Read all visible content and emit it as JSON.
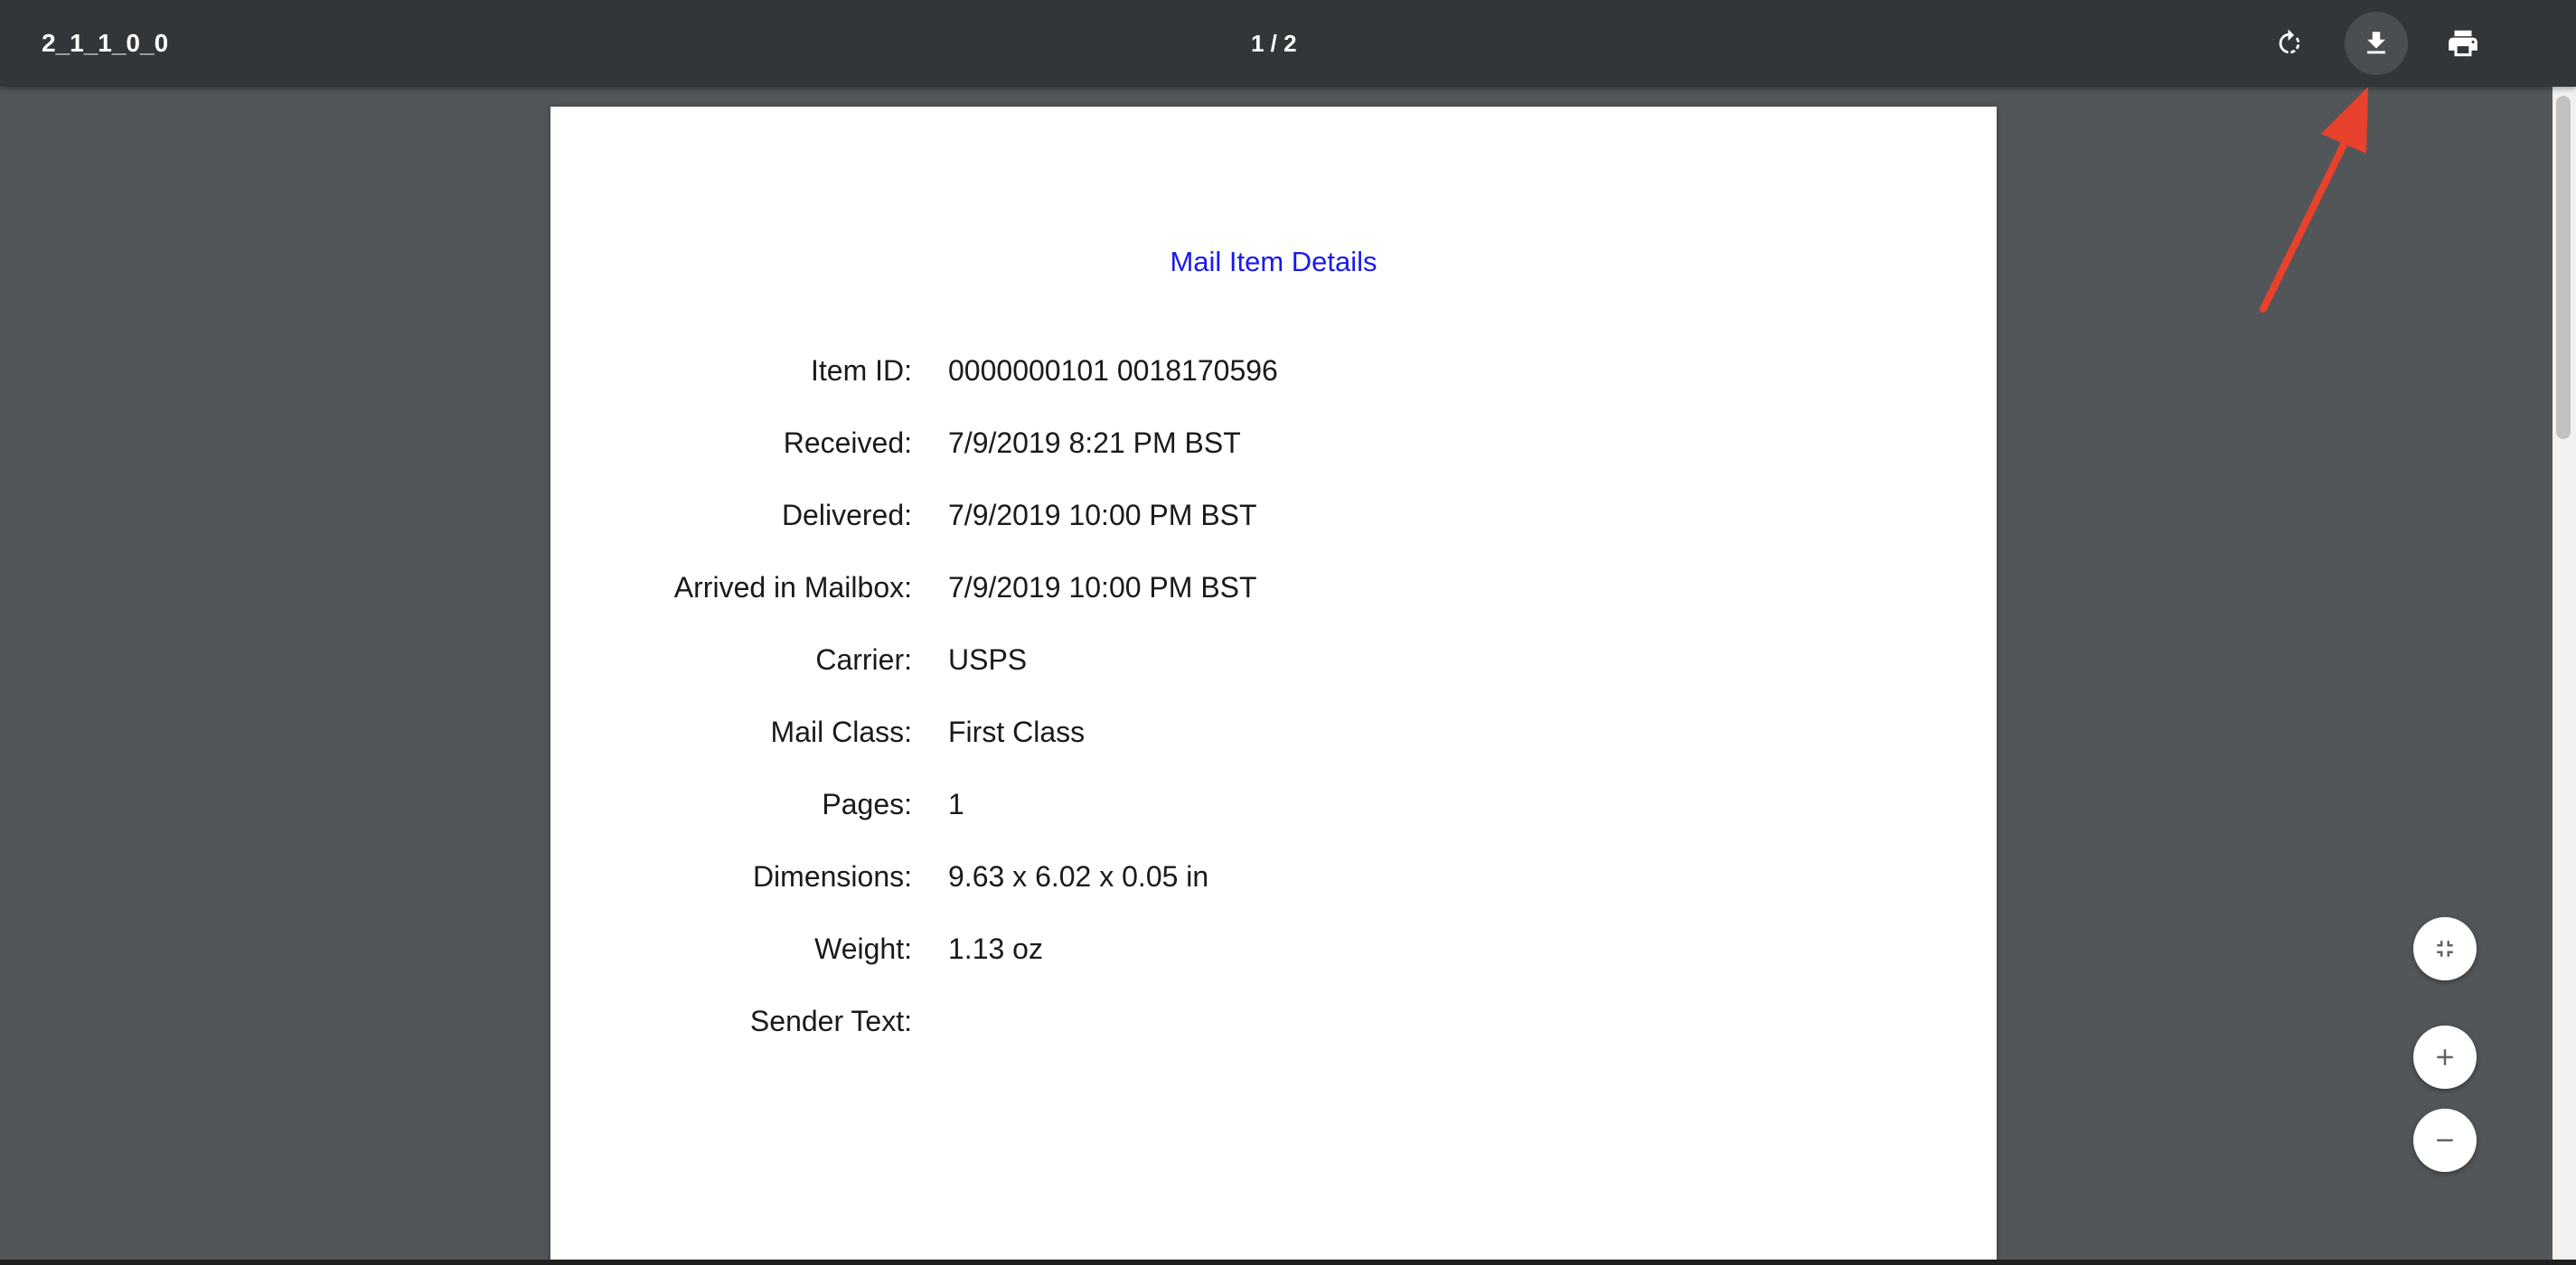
{
  "toolbar": {
    "title": "2_1_1_0_0",
    "page_indicator": "1 / 2",
    "icons": {
      "rotate": "rotate-clockwise-icon",
      "download": "download-icon",
      "print": "print-icon"
    }
  },
  "document": {
    "heading": "Mail Item Details",
    "heading_color": "#1a1aee",
    "rows": [
      {
        "label": "Item ID:",
        "value": "0000000101 0018170596"
      },
      {
        "label": "Received:",
        "value": "7/9/2019 8:21 PM BST"
      },
      {
        "label": "Delivered:",
        "value": "7/9/2019 10:00 PM BST"
      },
      {
        "label": "Arrived in Mailbox:",
        "value": "7/9/2019 10:00 PM BST"
      },
      {
        "label": "Carrier:",
        "value": "USPS"
      },
      {
        "label": "Mail Class:",
        "value": "First Class"
      },
      {
        "label": "Pages:",
        "value": "1"
      },
      {
        "label": "Dimensions:",
        "value": "9.63 x 6.02 x 0.05 in"
      },
      {
        "label": "Weight:",
        "value": "1.13 oz"
      },
      {
        "label": "Sender Text:",
        "value": ""
      }
    ]
  },
  "zoom_controls": {
    "icons": {
      "fit": "fit-to-page-icon",
      "zoom_in": "zoom-in-icon",
      "zoom_out": "zoom-out-icon"
    }
  },
  "colors": {
    "toolbar_bg": "#323639",
    "viewer_bg": "#525659",
    "annotation_arrow": "#e8412c"
  }
}
